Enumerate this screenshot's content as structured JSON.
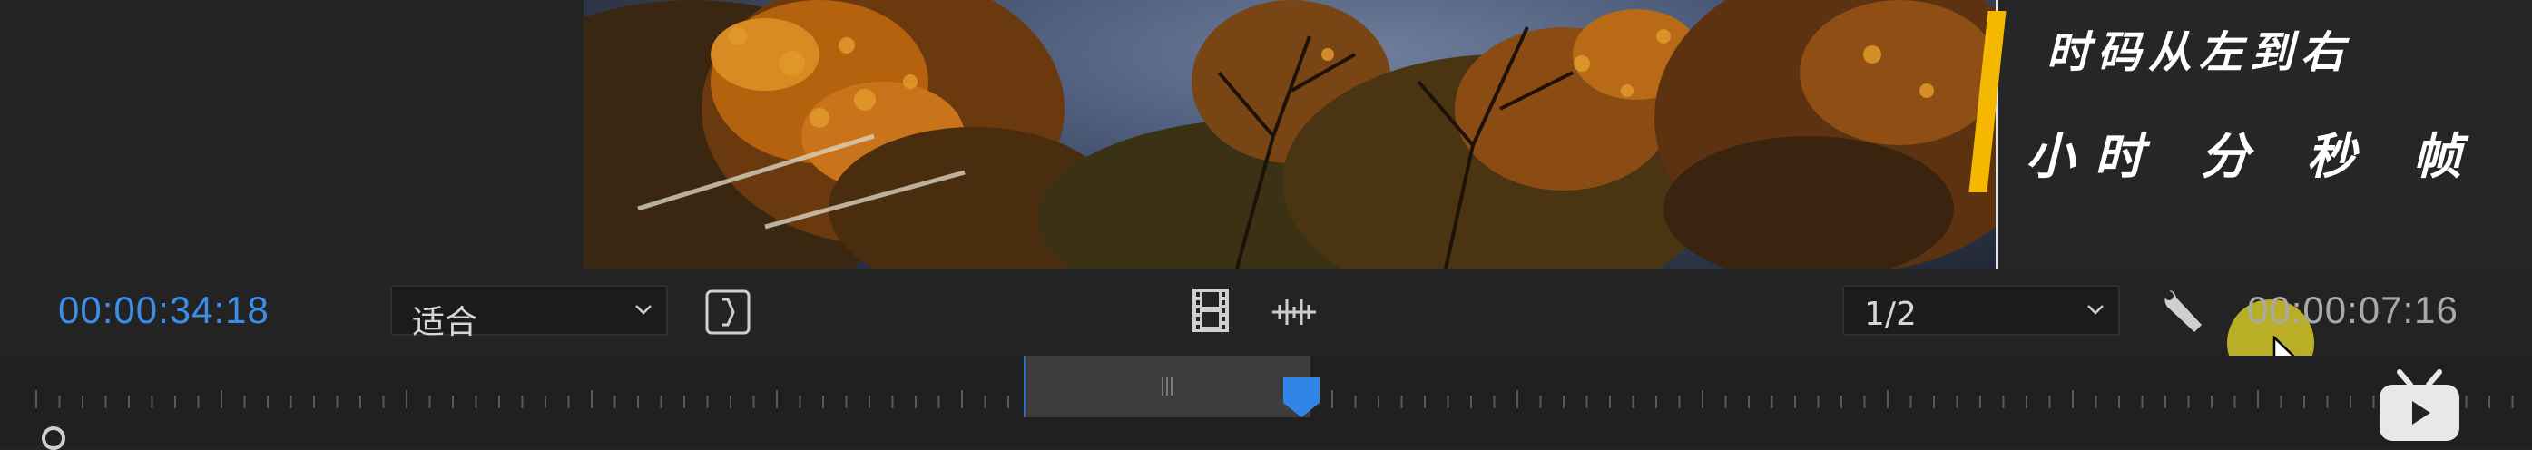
{
  "preview": {
    "caption_line1": "时码从左到右",
    "caption_line2": "小时 分 秒 帧"
  },
  "controls": {
    "current_timecode": "00:00:34:18",
    "fit_dropdown_value": "适合",
    "resolution_dropdown_value": "1/2",
    "duration_timecode": "00:00:07:16"
  },
  "icons": {
    "mark": "insert-mark-icon",
    "film": "film-frame-icon",
    "audio": "audio-waveform-icon",
    "wrench": "wrench-settings-icon",
    "dropdown": "chevron-down-icon",
    "pointer": "mouse-pointer-icon",
    "watermark": "bilibili-tv-icon"
  },
  "colors": {
    "timecode_accent": "#3b8de6",
    "caption_bar": "#f5b800",
    "playhead": "#2f86e8",
    "cursor_highlight": "#d2c828"
  }
}
